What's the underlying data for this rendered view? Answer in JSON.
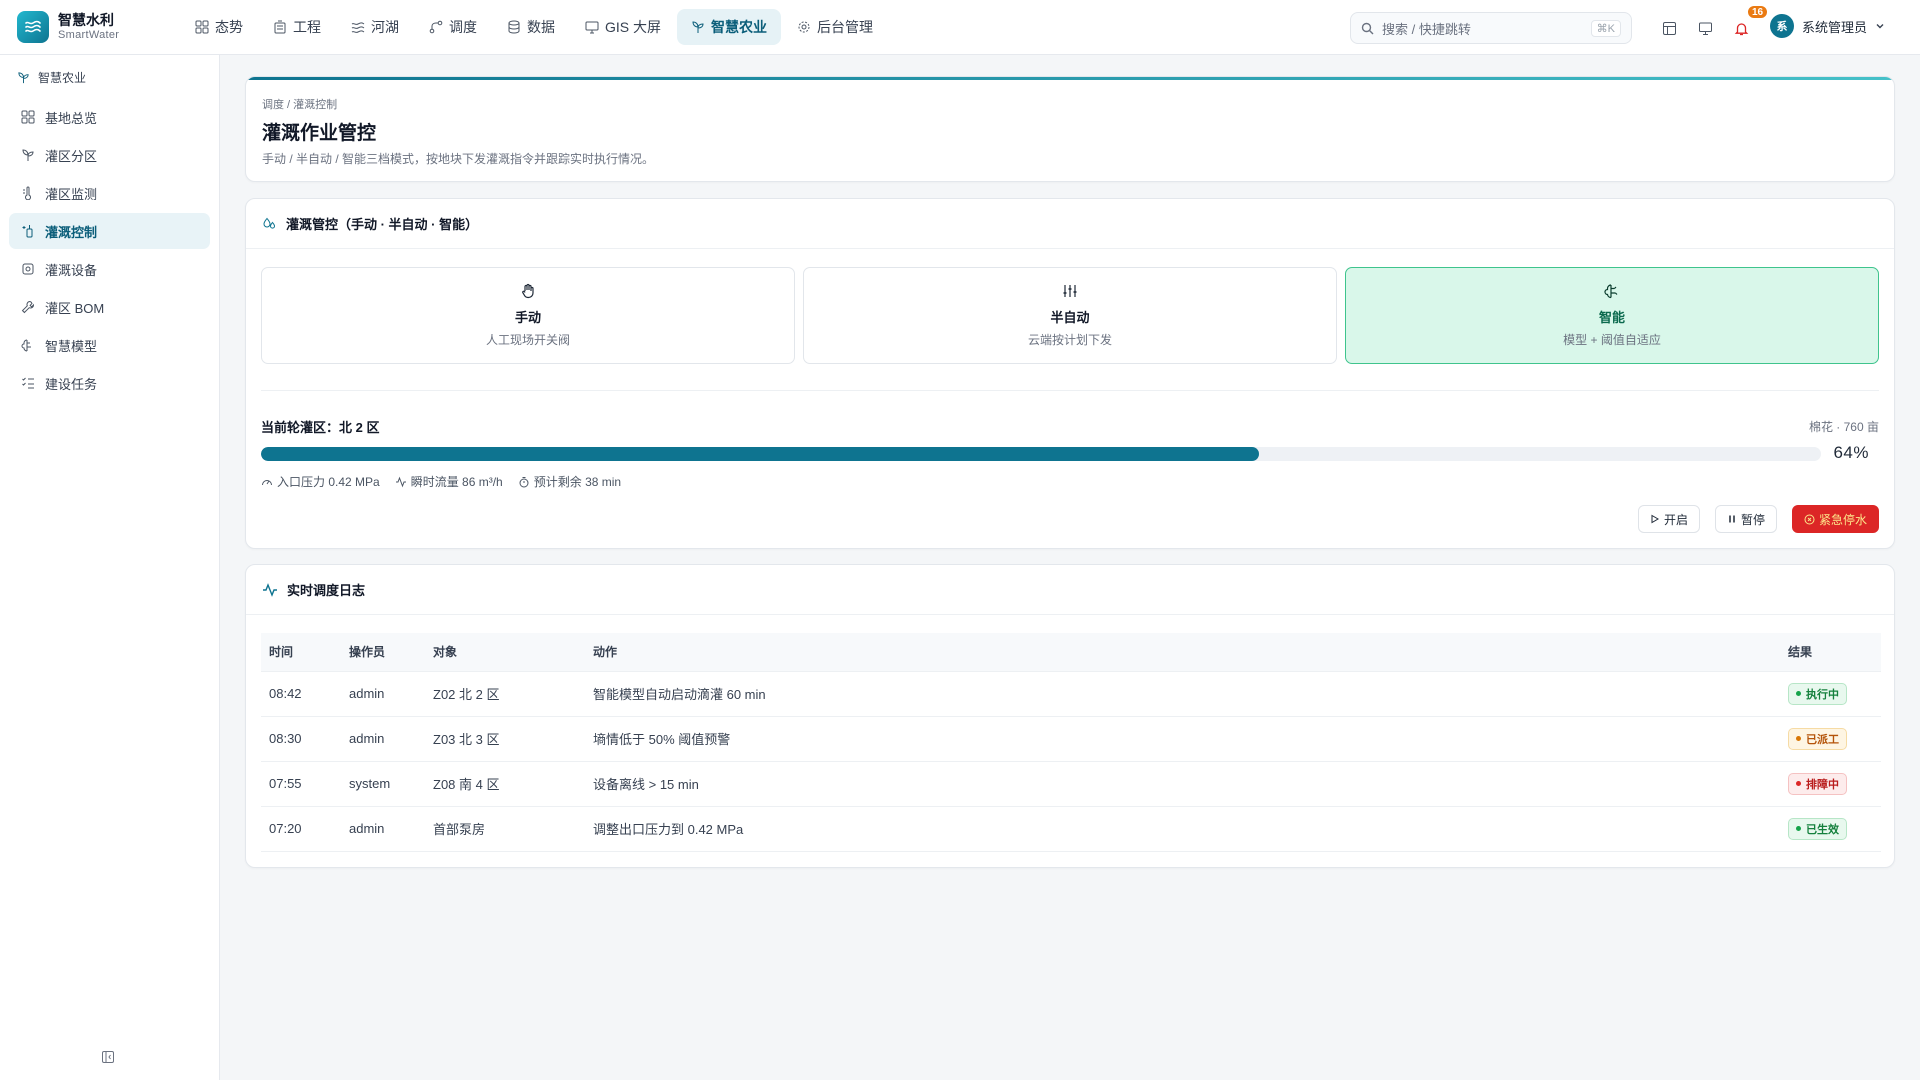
{
  "brand": {
    "name": "智慧水利",
    "sub": "SmartWater"
  },
  "topnav": [
    {
      "label": "态势",
      "icon": "grid-icon"
    },
    {
      "label": "工程",
      "icon": "building-icon"
    },
    {
      "label": "河湖",
      "icon": "waves-icon"
    },
    {
      "label": "调度",
      "icon": "route-icon"
    },
    {
      "label": "数据",
      "icon": "database-icon"
    },
    {
      "label": "GIS 大屏",
      "icon": "monitor-icon"
    },
    {
      "label": "智慧农业",
      "icon": "sprout-icon",
      "active": true
    },
    {
      "label": "后台管理",
      "icon": "gear-icon"
    }
  ],
  "search": {
    "placeholder": "搜索 / 快捷跳转",
    "shortcut": "⌘K"
  },
  "notifications": {
    "count": "16"
  },
  "user": {
    "avatar": "系",
    "name": "系统管理员"
  },
  "sidebar": {
    "title": "智慧农业",
    "items": [
      {
        "label": "基地总览",
        "icon": "grid-icon"
      },
      {
        "label": "灌区分区",
        "icon": "sprout-icon"
      },
      {
        "label": "灌区监测",
        "icon": "thermometer-icon"
      },
      {
        "label": "灌溉控制",
        "icon": "irrigation-icon",
        "active": true
      },
      {
        "label": "灌溉设备",
        "icon": "cog-icon"
      },
      {
        "label": "灌区 BOM",
        "icon": "wrench-icon"
      },
      {
        "label": "智慧模型",
        "icon": "brain-icon"
      },
      {
        "label": "建设任务",
        "icon": "list-check-icon"
      }
    ]
  },
  "page": {
    "breadcrumb": "调度 / 灌溉控制",
    "title": "灌溉作业管控",
    "desc": "手动 / 半自动 / 智能三档模式，按地块下发灌溉指令并跟踪实时执行情况。"
  },
  "control": {
    "title": "灌溉管控（手动 · 半自动 · 智能）",
    "modes": [
      {
        "name": "手动",
        "desc": "人工现场开关阀",
        "icon": "hand-icon"
      },
      {
        "name": "半自动",
        "desc": "云端按计划下发",
        "icon": "sliders-icon"
      },
      {
        "name": "智能",
        "desc": "模型 + 阈值自适应",
        "icon": "brain-icon",
        "active": true
      }
    ],
    "zone_label": "当前轮灌区：北 2 区",
    "zone_meta": "棉花 · 760 亩",
    "progress": 0.64,
    "progress_text": "64%",
    "metrics": [
      {
        "label": "入口压力 0.42 MPa",
        "icon": "gauge-icon"
      },
      {
        "label": "瞬时流量 86 m³/h",
        "icon": "activity-icon"
      },
      {
        "label": "预计剩余 38 min",
        "icon": "timer-icon"
      }
    ],
    "actions": {
      "start": "开启",
      "pause": "暂停",
      "stop": "紧急停水"
    }
  },
  "log": {
    "title": "实时调度日志",
    "columns": [
      "时间",
      "操作员",
      "对象",
      "动作",
      "结果"
    ],
    "rows": [
      {
        "time": "08:42",
        "operator": "admin",
        "target": "Z02 北 2 区",
        "action": "智能模型自动启动滴灌 60 min",
        "result": "执行中",
        "tone": "green"
      },
      {
        "time": "08:30",
        "operator": "admin",
        "target": "Z03 北 3 区",
        "action": "墒情低于 50% 阈值预警",
        "result": "已派工",
        "tone": "amber"
      },
      {
        "time": "07:55",
        "operator": "system",
        "target": "Z08 南 4 区",
        "action": "设备离线 > 15 min",
        "result": "排障中",
        "tone": "red"
      },
      {
        "time": "07:20",
        "operator": "admin",
        "target": "首部泵房",
        "action": "调整出口压力到 0.42 MPa",
        "result": "已生效",
        "tone": "green"
      }
    ]
  },
  "colors": {
    "accent": "#0e7490",
    "green": "#16a34a",
    "amber": "#d97706",
    "red": "#dc2626"
  }
}
